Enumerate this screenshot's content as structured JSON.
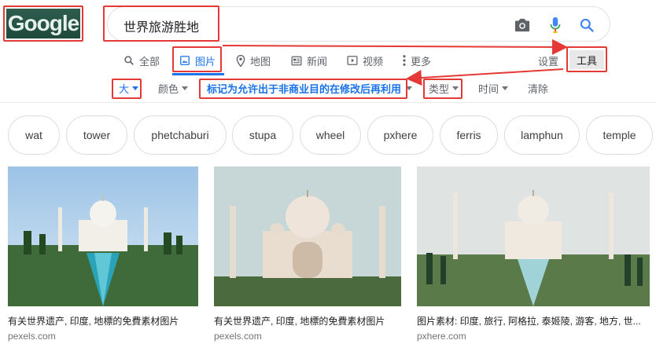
{
  "logo": {
    "text": "Google"
  },
  "search": {
    "query": "世界旅游胜地"
  },
  "tabs": [
    {
      "label": "全部",
      "icon": "search-icon"
    },
    {
      "label": "图片",
      "icon": "image-icon",
      "active": true
    },
    {
      "label": "地图",
      "icon": "map-pin-icon"
    },
    {
      "label": "新闻",
      "icon": "newspaper-icon"
    },
    {
      "label": "视频",
      "icon": "play-icon"
    },
    {
      "label": "更多",
      "icon": "more-vert-icon"
    }
  ],
  "settings_label": "设置",
  "tools_label": "工具",
  "tools_row": {
    "size": "大",
    "color": "颜色",
    "usage_rights": "标记为允许出于非商业目的在修改后再利用",
    "type": "类型",
    "time": "时间",
    "clear": "清除"
  },
  "chips": [
    "wat",
    "tower",
    "phetchaburi",
    "stupa",
    "wheel",
    "pxhere",
    "ferris",
    "lamphun",
    "temple"
  ],
  "results": [
    {
      "title": "有关世界遗产, 印度, 地標的免費素材图片",
      "source": "pexels.com"
    },
    {
      "title": "有关世界遗产, 印度, 地標的免費素材图片",
      "source": "pexels.com"
    },
    {
      "title": "图片素材: 印度, 旅行, 阿格拉, 泰姬陵, 游客, 地方, 世...",
      "source": "pxhere.com"
    }
  ],
  "colors": {
    "accent": "#1a73e8",
    "annotation": "#e53935"
  }
}
